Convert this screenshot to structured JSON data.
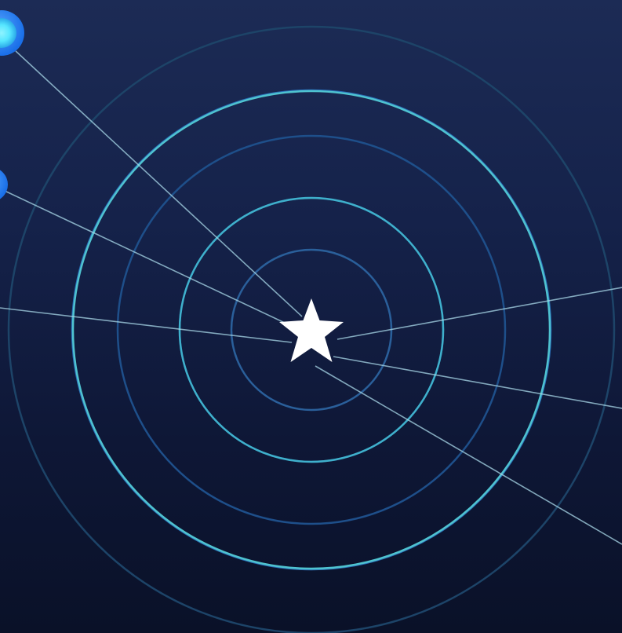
{
  "colors": {
    "bg_top": "#1c2b55",
    "bg_bottom": "#0a1128",
    "ring_cyan": "#4fc3d0",
    "ring_blue": "#1e63c6",
    "ring_dim": "#1f4d78",
    "line": "#a9d8e8",
    "star": "#ffffff",
    "node_outer": "#2f86ff",
    "node_inner": "#56e6ff"
  },
  "icons": {
    "center": "star-icon",
    "nodes": "orbit-node-icon"
  }
}
